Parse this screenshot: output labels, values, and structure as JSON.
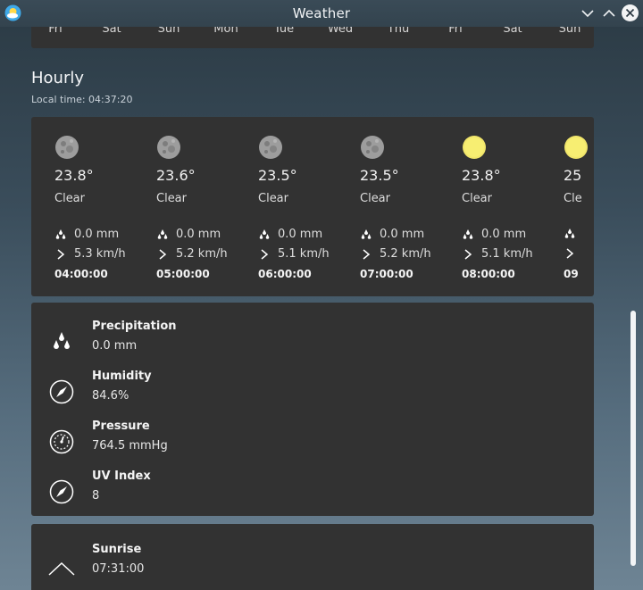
{
  "window": {
    "title": "Weather"
  },
  "daily": {
    "days": [
      "Fri",
      "Sat",
      "Sun",
      "Mon",
      "Tue",
      "Wed",
      "Thu",
      "Fri",
      "Sat",
      "Sun"
    ]
  },
  "hourly": {
    "title": "Hourly",
    "local_time": "Local time: 04:37:20",
    "items": [
      {
        "icon": "moon-icon",
        "temp": "23.8°",
        "condition": "Clear",
        "precip": "0.0 mm",
        "wind": "5.3 km/h",
        "time": "04:00:00"
      },
      {
        "icon": "moon-icon",
        "temp": "23.6°",
        "condition": "Clear",
        "precip": "0.0 mm",
        "wind": "5.2 km/h",
        "time": "05:00:00"
      },
      {
        "icon": "moon-icon",
        "temp": "23.5°",
        "condition": "Clear",
        "precip": "0.0 mm",
        "wind": "5.1 km/h",
        "time": "06:00:00"
      },
      {
        "icon": "moon-icon",
        "temp": "23.5°",
        "condition": "Clear",
        "precip": "0.0 mm",
        "wind": "5.2 km/h",
        "time": "07:00:00"
      },
      {
        "icon": "sun-icon",
        "temp": "23.8°",
        "condition": "Clear",
        "precip": "0.0 mm",
        "wind": "5.1 km/h",
        "time": "08:00:00"
      },
      {
        "icon": "sun-icon",
        "temp": "25",
        "condition": "Cle",
        "precip": "",
        "wind": "",
        "time": "09"
      }
    ]
  },
  "details": {
    "precipitation": {
      "label": "Precipitation",
      "value": "0.0 mm",
      "icon": "raindrops-icon"
    },
    "humidity": {
      "label": "Humidity",
      "value": "84.6%",
      "icon": "compass-icon"
    },
    "pressure": {
      "label": "Pressure",
      "value": "764.5 mmHg",
      "icon": "gauge-icon"
    },
    "uv_index": {
      "label": "UV Index",
      "value": "8",
      "icon": "compass-icon"
    }
  },
  "sun": {
    "sunrise": {
      "label": "Sunrise",
      "value": "07:31:00",
      "icon": "sunrise-chevron-icon"
    }
  },
  "colors": {
    "card": "#323232",
    "moon": "#9a9a9a",
    "sun": "#f4ea6a",
    "accent": "#f2f4f6"
  }
}
